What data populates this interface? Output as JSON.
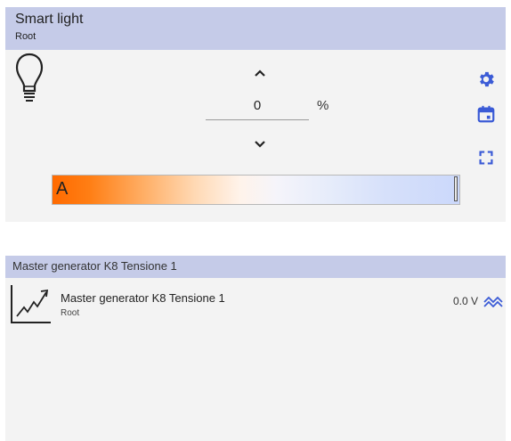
{
  "smart_light": {
    "title": "Smart light",
    "subtitle": "Root",
    "value": "0",
    "unit": "%",
    "bar_label": "A",
    "bar_level_fraction": 1.0,
    "icons": [
      "lightbulb-icon",
      "chevron-up-icon",
      "chevron-down-icon",
      "gear-icon",
      "calendar-icon",
      "expand-icon"
    ],
    "colors": {
      "header": "#c5cbe8",
      "accent": "#3b5bd6",
      "bar_warm": "#ff6a00",
      "bar_cool": "#cbd8fb"
    }
  },
  "master_generator": {
    "header_title": "Master generator K8 Tensione 1",
    "item_title": "Master generator K8 Tensione 1",
    "item_subtitle": "Root",
    "value": "0.0 V",
    "icons": [
      "trend-chart-icon",
      "wave-icon"
    ]
  }
}
